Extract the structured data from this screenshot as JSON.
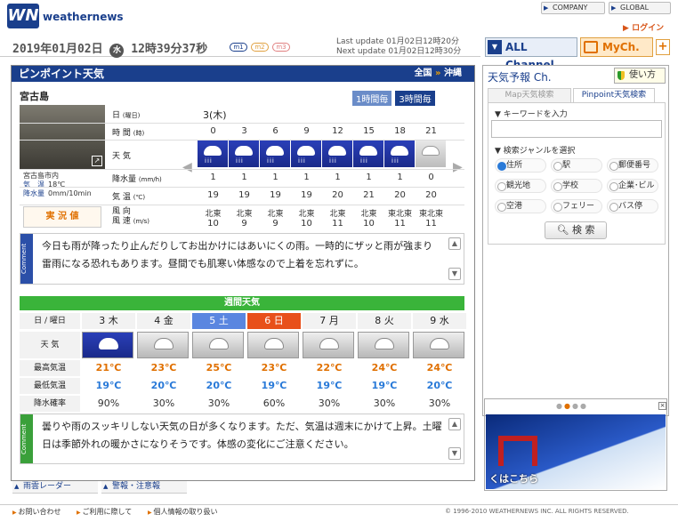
{
  "brand": {
    "logo_mark": "WN",
    "logo_text": "weathernews"
  },
  "top_links": {
    "company": "COMPANY",
    "global": "GLOBAL",
    "login": "ログイン"
  },
  "datetime": {
    "date": "2019年01月02日",
    "weekday": "水",
    "time": "12時39分37秒"
  },
  "chips": [
    "m1",
    "m2",
    "m3"
  ],
  "updates": {
    "last": "Last update  01月02日12時20分",
    "next": "Next update  01月02日12時30分"
  },
  "channels": {
    "all": "ALL Channel",
    "my": "MyCh.",
    "plus": "+"
  },
  "panel": {
    "title": "ピンポイント天気",
    "region": "全国",
    "sep": "»",
    "pref": "沖縄"
  },
  "location": {
    "name": "宮古島",
    "photo_place": "宮古島市内",
    "obs": [
      {
        "k": "気　温",
        "v": "18℃"
      },
      {
        "k": "降水量",
        "v": "0mm/10min"
      }
    ],
    "jikkyo": "実 況 値"
  },
  "interval": {
    "one": "1時間毎",
    "three": "3時間毎"
  },
  "hourly": {
    "date": "3(木)",
    "labels": {
      "day": "日",
      "day_sub": "(曜日)",
      "time": "時 間",
      "time_sub": "(時)",
      "weather": "天 気",
      "precip": "降水量",
      "precip_sub": "(mm/h)",
      "temp": "気 温",
      "temp_sub": "(℃)",
      "wind": "風 向",
      "wind2": "風 速",
      "wind_sub": "(m/s)"
    },
    "hours": [
      "0",
      "3",
      "6",
      "9",
      "12",
      "15",
      "18",
      "21"
    ],
    "weather": [
      "rain",
      "rain",
      "rain",
      "rain",
      "rain",
      "rain",
      "rain",
      "cloudy"
    ],
    "precip": [
      "1",
      "1",
      "1",
      "1",
      "1",
      "1",
      "1",
      "0"
    ],
    "temp": [
      "19",
      "19",
      "19",
      "19",
      "20",
      "21",
      "20",
      "20"
    ],
    "wind_dir": [
      "北東",
      "北東",
      "北東",
      "北東",
      "北東",
      "北東",
      "東北東",
      "東北東"
    ],
    "wind_speed": [
      "10",
      "9",
      "9",
      "10",
      "11",
      "10",
      "11",
      "11"
    ]
  },
  "comment1": "今日も雨が降ったり止んだりしてお出かけにはあいにくの雨。一時的にザッと雨が強まり雷雨になる恐れもあります。昼間でも肌寒い体感なので上着を忘れずに。",
  "comment_tag": "Comment",
  "weekly": {
    "title": "週間天気",
    "labels": {
      "day": "日 / 曜日",
      "weather": "天 気",
      "hi": "最高気温",
      "lo": "最低気温",
      "rain": "降水確率"
    },
    "days": [
      "3 木",
      "4 金",
      "5 土",
      "6 日",
      "7 月",
      "8 火",
      "9 水"
    ],
    "weather": [
      "rain-cloud",
      "cloudy",
      "cloudy",
      "cloudy-rain",
      "cloudy",
      "cloudy",
      "cloudy"
    ],
    "hi": [
      "21℃",
      "23℃",
      "25℃",
      "23℃",
      "22℃",
      "24℃",
      "24℃"
    ],
    "lo": [
      "19℃",
      "20℃",
      "20℃",
      "19℃",
      "19℃",
      "19℃",
      "20℃"
    ],
    "rain": [
      "90%",
      "30%",
      "30%",
      "60%",
      "30%",
      "30%",
      "30%"
    ]
  },
  "comment2": "曇りや雨のスッキリしない天気の日が多くなります。ただ、気温は週末にかけて上昇。土曜日は季節外れの暖かさになりそうです。体感の変化にご注意ください。",
  "right": {
    "title": "天気予報 Ch.",
    "usage": "使い方",
    "tab_map": "Map天気検索",
    "tab_pin": "Pinpoint天気検索",
    "kw_label": "▼ キーワードを入力",
    "genre_label": "▼ 検索ジャンルを選択",
    "genres": [
      "住所",
      "駅",
      "郵便番号",
      "観光地",
      "学校",
      "企業･ビル",
      "空港",
      "フェリー",
      "バス停"
    ],
    "search": "検 索",
    "banner_text": "くはこちら"
  },
  "bottom_links": {
    "radar": "雨雲レーダー",
    "warn": "警報・注意報"
  },
  "footer": {
    "links": [
      "お問い合わせ",
      "ご利用に際して",
      "個人情報の取り扱い"
    ],
    "copyright": "© 1996-2010 WEATHERNEWS INC. ALL RIGHTS RESERVED."
  }
}
